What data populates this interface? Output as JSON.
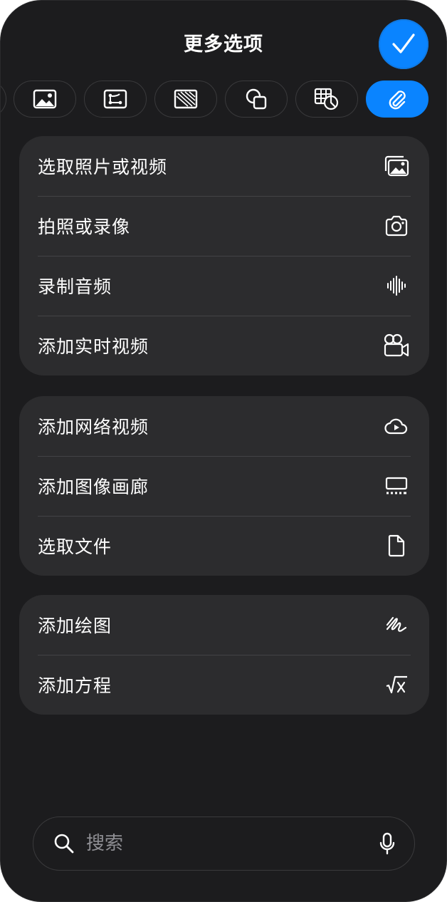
{
  "header": {
    "title": "更多选项"
  },
  "colors": {
    "accent": "#0a84ff",
    "sheet": "#1c1c1e",
    "group": "#2c2c2e"
  },
  "toolbar": {
    "items": [
      {
        "icon": "image-icon"
      },
      {
        "icon": "diagram-icon"
      },
      {
        "icon": "pattern-icon"
      },
      {
        "icon": "shapes-icon"
      },
      {
        "icon": "table-chart-icon"
      },
      {
        "icon": "paperclip-icon",
        "selected": true
      }
    ]
  },
  "groups": [
    {
      "items": [
        {
          "label": "选取照片或视频",
          "icon": "photo-library-icon"
        },
        {
          "label": "拍照或录像",
          "icon": "camera-icon"
        },
        {
          "label": "录制音频",
          "icon": "waveform-icon"
        },
        {
          "label": "添加实时视频",
          "icon": "video-camera-icon"
        }
      ]
    },
    {
      "items": [
        {
          "label": "添加网络视频",
          "icon": "cloud-play-icon"
        },
        {
          "label": "添加图像画廊",
          "icon": "gallery-icon"
        },
        {
          "label": "选取文件",
          "icon": "document-icon"
        }
      ]
    },
    {
      "items": [
        {
          "label": "添加绘图",
          "icon": "scribble-icon"
        },
        {
          "label": "添加方程",
          "icon": "square-root-icon"
        }
      ]
    }
  ],
  "search": {
    "placeholder": "搜索",
    "value": ""
  }
}
